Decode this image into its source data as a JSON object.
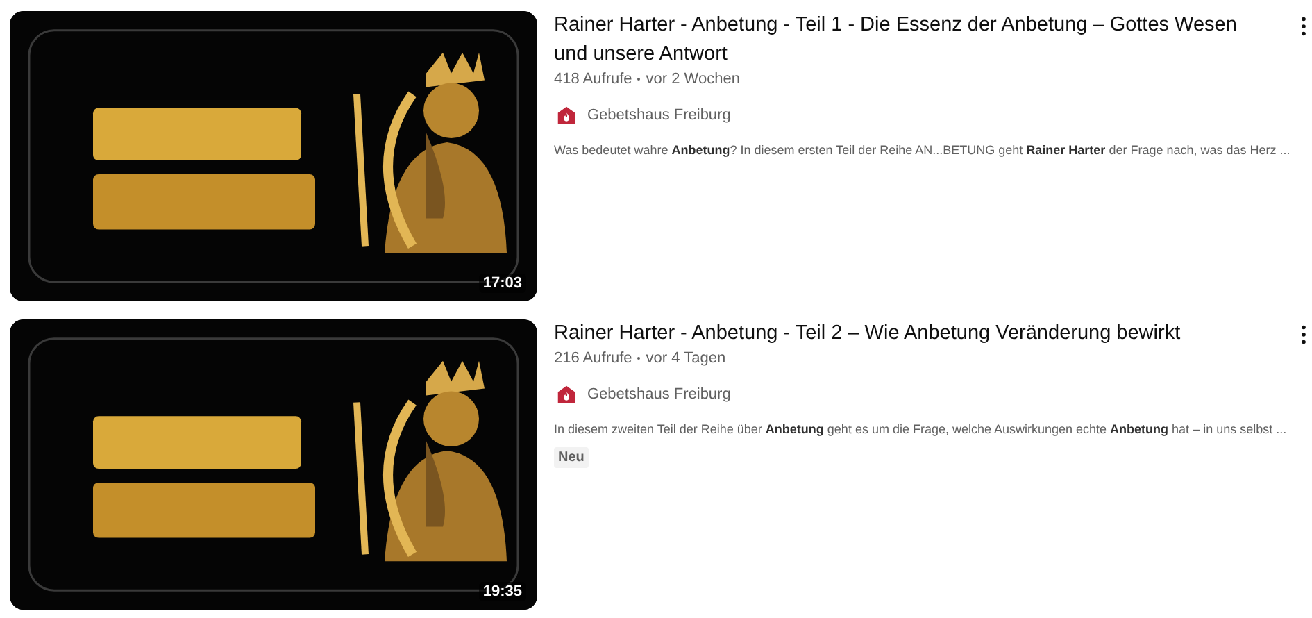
{
  "videos": [
    {
      "thumbnail": {
        "kind": "picture"
      },
      "duration": "17:03",
      "title": "Rainer Harter - Anbetung - Teil 1 - Die Essenz der Anbetung – Gottes Wesen und unsere Antwort",
      "views": "418 Aufrufe",
      "age": "vor 2 Wochen",
      "channel": "Gebetshaus Freiburg",
      "description": "Was bedeutet wahre **Anbetung**? In diesem ersten Teil der Reihe AN...BETUNG geht **Rainer Harter** der Frage nach, was das Herz ..."
    },
    {
      "thumbnail": {
        "kind": "picture"
      },
      "duration": "19:35",
      "title": "Rainer Harter - Anbetung - Teil 2 – Wie Anbetung Veränderung bewirkt",
      "views": "216 Aufrufe",
      "age": "vor 4 Tagen",
      "channel": "Gebetshaus Freiburg",
      "description": "In diesem zweiten Teil der Reihe über **Anbetung** geht es um die Frage, welche Auswirkungen echte **Anbetung** hat – in uns selbst ...",
      "badges": [
        "Neu"
      ]
    }
  ]
}
